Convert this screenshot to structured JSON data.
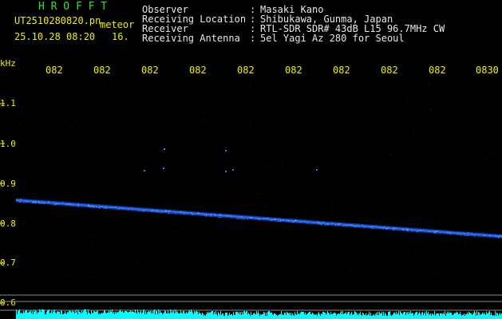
{
  "header": {
    "program": "H R O F F T",
    "filename": "UT2510280820.pn",
    "tag": "meteor",
    "datetime": "25.10.28 08:20",
    "frame": "16.",
    "fields": [
      {
        "label": "Observer",
        "value": "Masaki Kano"
      },
      {
        "label": "Receiving Location",
        "value": "Shibukawa, Gunma, Japan"
      },
      {
        "label": "Receiver",
        "value": "RTL-SDR SDR# 43dB L15 96.7MHz CW"
      },
      {
        "label": "Receiving Antenna",
        "value": "5el Yagi Az 280 for Seoul"
      }
    ]
  },
  "chart_data": {
    "type": "line",
    "ylabel": "kHz",
    "y_tick_labels": [
      "1.1",
      "1.0",
      "0.9",
      "0.8",
      "0.7",
      "0.6"
    ],
    "x_tick_labels": [
      "082",
      "082",
      "082",
      "082",
      "082",
      "082",
      "082",
      "082",
      "082",
      "0830"
    ],
    "series": [
      {
        "values_x_fraction": [
          0.0,
          1.0
        ],
        "values_khz": [
          0.858,
          0.767
        ]
      }
    ],
    "colors": {
      "text": "#f0f000",
      "signal": "#2a6cff",
      "noise": "#00ffff",
      "grid": "#808080"
    }
  }
}
